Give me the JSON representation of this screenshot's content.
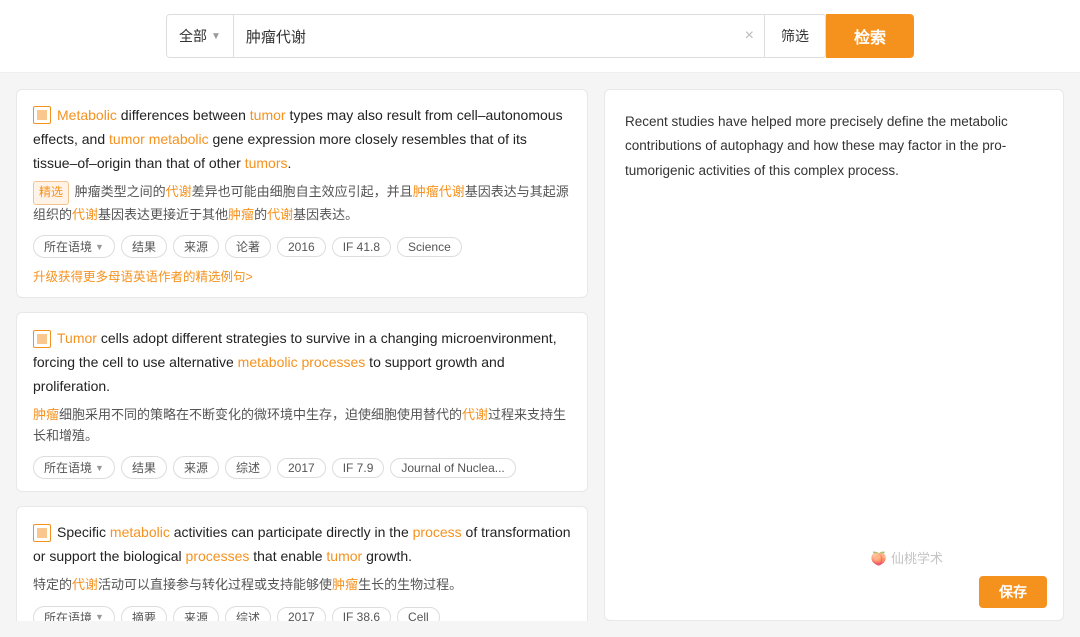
{
  "search": {
    "category_label": "全部",
    "query": "肿瘤代谢",
    "filter_label": "筛选",
    "search_label": "检索",
    "clear_icon": "×"
  },
  "right_panel": {
    "text": "Recent studies have helped more precisely define the metabolic contributions of autophagy and how these may factor in the pro-tumorigenic activities of this complex process."
  },
  "results": [
    {
      "id": "result-1",
      "en_parts": [
        {
          "text": "Metabolic",
          "type": "orange"
        },
        {
          "text": " differences between ",
          "type": "normal"
        },
        {
          "text": "tumor",
          "type": "orange"
        },
        {
          "text": " types may also result from cell–autonomous effects, and ",
          "type": "normal"
        },
        {
          "text": "tumor",
          "type": "orange"
        },
        {
          "text": " ",
          "type": "normal"
        },
        {
          "text": "metabolic",
          "type": "orange"
        },
        {
          "text": " gene expression more closely resembles that of its tissue–of–origin than that of other ",
          "type": "normal"
        },
        {
          "text": "tumors",
          "type": "orange"
        },
        {
          "text": ".",
          "type": "normal"
        }
      ],
      "zh_prefix": "精选",
      "zh_text": "肿瘤类型之间的代谢差异也可能由细胞自主效应引起，并且肿瘤代谢基因表达与其起源组织的代谢基因表达更接近于其他肿瘤的代谢基因表达。",
      "tags": [
        "所在语境",
        "结果",
        "来源",
        "论著",
        "2016",
        "IF 41.8",
        "Science"
      ],
      "upgrade_text": "升级获得更多母语英语作者的精选例句>",
      "year": "2016",
      "if_score": "IF 41.8",
      "journal": "Science",
      "tag_types": [
        "dropdown",
        "normal",
        "normal",
        "normal",
        "normal",
        "normal",
        "normal"
      ]
    },
    {
      "id": "result-2",
      "en_parts": [
        {
          "text": "Tumor",
          "type": "orange"
        },
        {
          "text": " cells adopt different strategies to survive in a changing microenvironment, forcing the cell to use alternative ",
          "type": "normal"
        },
        {
          "text": "metabolic processes",
          "type": "orange"
        },
        {
          "text": " to support growth and proliferation.",
          "type": "normal"
        }
      ],
      "zh_text": "肿瘤细胞采用不同的策略在不断变化的微环境中生存，迫使细胞使用替代的代谢过程来支持生长和增殖。",
      "tags": [
        "所在语境",
        "结果",
        "来源",
        "综述",
        "2017",
        "IF 7.9",
        "Journal of Nuclea..."
      ],
      "year": "2017",
      "if_score": "IF 7.9",
      "journal": "Journal of Nuclea...",
      "tag_types": [
        "dropdown",
        "normal",
        "normal",
        "normal",
        "normal",
        "normal",
        "normal"
      ]
    },
    {
      "id": "result-3",
      "en_parts": [
        {
          "text": "Specific ",
          "type": "normal"
        },
        {
          "text": "metabolic",
          "type": "orange"
        },
        {
          "text": " activities can participate directly in the ",
          "type": "normal"
        },
        {
          "text": "process",
          "type": "orange"
        },
        {
          "text": " of transformation or support the biological ",
          "type": "normal"
        },
        {
          "text": "processes",
          "type": "orange"
        },
        {
          "text": " that enable ",
          "type": "normal"
        },
        {
          "text": "tumor",
          "type": "orange"
        },
        {
          "text": " growth.",
          "type": "normal"
        }
      ],
      "zh_text": "特定的代谢活动可以直接参与转化过程或支持能够使肿瘤生长的生物过程。",
      "tags": [
        "所在语境",
        "摘要",
        "来源",
        "综述",
        "2017",
        "IF 38.6",
        "Cell"
      ],
      "year": "2017",
      "if_score": "IF 38.6",
      "journal": "Cell",
      "tag_types": [
        "dropdown",
        "normal",
        "normal",
        "normal",
        "normal",
        "normal",
        "normal"
      ]
    }
  ],
  "watermark": "仙桃学术",
  "save_label": "保存"
}
